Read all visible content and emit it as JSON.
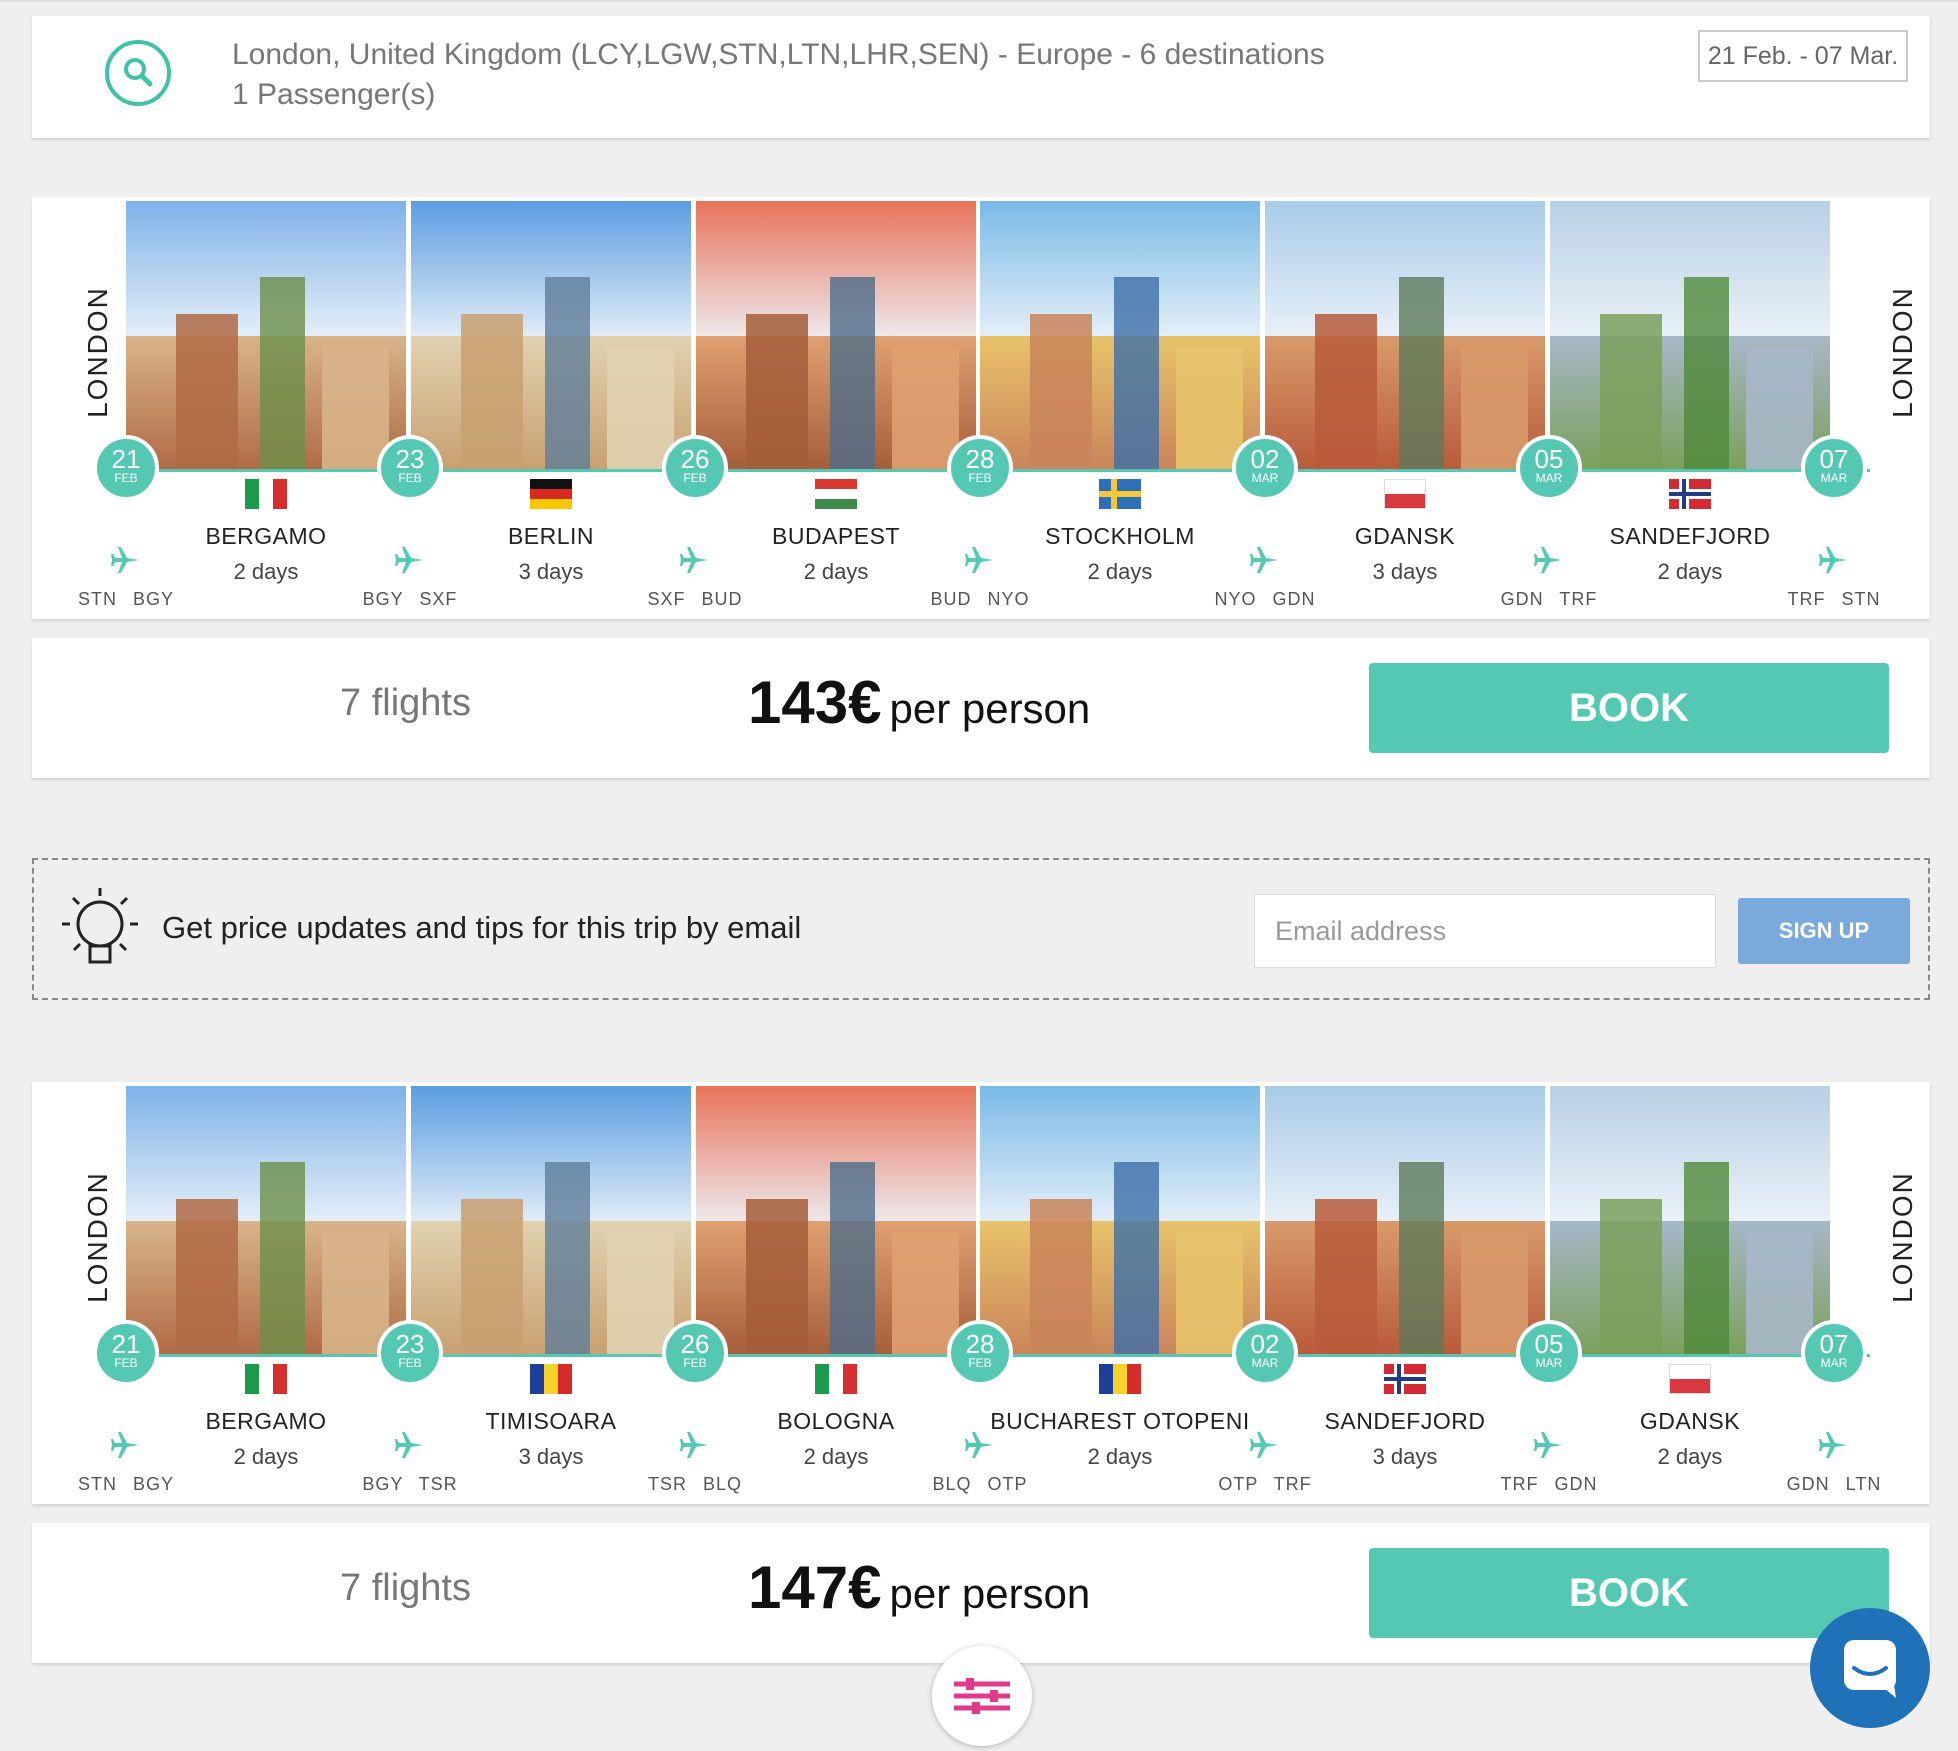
{
  "search": {
    "title": "London, United Kingdom (LCY,LGW,STN,LTN,LHR,SEN) - Europe - 6 destinations",
    "passengers": "1 Passenger(s)",
    "dates": "21 Feb. - 07 Mar."
  },
  "email_signup": {
    "text": "Get price updates and tips for this trip by email",
    "placeholder": "Email address",
    "button": "SIGN UP"
  },
  "trips": [
    {
      "origin": "LONDON",
      "destination_end": "LONDON",
      "dates": [
        {
          "day": "21",
          "month": "FEB"
        },
        {
          "day": "23",
          "month": "FEB"
        },
        {
          "day": "26",
          "month": "FEB"
        },
        {
          "day": "28",
          "month": "FEB"
        },
        {
          "day": "02",
          "month": "MAR"
        },
        {
          "day": "05",
          "month": "MAR"
        },
        {
          "day": "07",
          "month": "MAR"
        }
      ],
      "cities": [
        {
          "name": "BERGAMO",
          "days": "2 days",
          "flag": "italy-flag"
        },
        {
          "name": "BERLIN",
          "days": "3 days",
          "flag": "germany-flag"
        },
        {
          "name": "BUDAPEST",
          "days": "2 days",
          "flag": "hungary-flag"
        },
        {
          "name": "STOCKHOLM",
          "days": "2 days",
          "flag": "sweden-flag"
        },
        {
          "name": "GDANSK",
          "days": "3 days",
          "flag": "poland-flag"
        },
        {
          "name": "SANDEFJORD",
          "days": "2 days",
          "flag": "norway-flag"
        }
      ],
      "legs": [
        "STN BGY",
        "BGY SXF",
        "SXF BUD",
        "BUD NYO",
        "NYO GDN",
        "GDN TRF",
        "TRF STN"
      ],
      "flights": "7 flights",
      "price": "143€",
      "per_person": "per person",
      "book": "BOOK"
    },
    {
      "origin": "LONDON",
      "destination_end": "LONDON",
      "dates": [
        {
          "day": "21",
          "month": "FEB"
        },
        {
          "day": "23",
          "month": "FEB"
        },
        {
          "day": "26",
          "month": "FEB"
        },
        {
          "day": "28",
          "month": "FEB"
        },
        {
          "day": "02",
          "month": "MAR"
        },
        {
          "day": "05",
          "month": "MAR"
        },
        {
          "day": "07",
          "month": "MAR"
        }
      ],
      "cities": [
        {
          "name": "BERGAMO",
          "days": "2 days",
          "flag": "italy-flag"
        },
        {
          "name": "TIMISOARA",
          "days": "3 days",
          "flag": "romania-flag"
        },
        {
          "name": "BOLOGNA",
          "days": "2 days",
          "flag": "italy-flag"
        },
        {
          "name": "BUCHAREST OTOPENI",
          "days": "2 days",
          "flag": "romania-flag"
        },
        {
          "name": "SANDEFJORD",
          "days": "3 days",
          "flag": "norway-flag"
        },
        {
          "name": "GDANSK",
          "days": "2 days",
          "flag": "poland-flag"
        }
      ],
      "legs": [
        "STN BGY",
        "BGY TSR",
        "TSR BLQ",
        "BLQ OTP",
        "OTP TRF",
        "TRF GDN",
        "GDN LTN"
      ],
      "flights": "7 flights",
      "price": "147€",
      "per_person": "per person",
      "book": "BOOK"
    }
  ],
  "colors": {
    "accent": "#55c8b4",
    "signup": "#7aa9db",
    "chat": "#1f72b8",
    "filter": "#e03a8f"
  }
}
